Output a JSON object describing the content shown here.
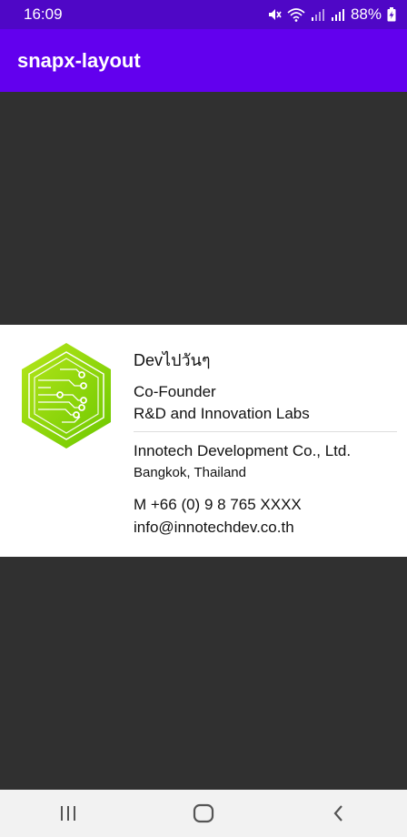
{
  "status_bar": {
    "time": "16:09",
    "battery": "88%",
    "icons": [
      "mute-icon",
      "wifi-icon",
      "signal-icon",
      "signal-icon",
      "battery-charging-icon"
    ]
  },
  "app_bar": {
    "title": "snapx-layout"
  },
  "card": {
    "name": "Devไปวันๆ",
    "role": "Co-Founder",
    "department": "R&D and Innovation Labs",
    "company": "Innotech Development Co., Ltd.",
    "location": "Bangkok, Thailand",
    "phone": "M +66 (0) 9 8 765 XXXX",
    "email": "info@innotechdev.co.th",
    "logo_icon": "circuit-hexagon-logo",
    "logo_color": "#8cd600"
  },
  "nav_bar": {
    "icons": [
      "recents-icon",
      "home-icon",
      "back-icon"
    ]
  },
  "colors": {
    "status_bar": "#4f07c6",
    "app_bar": "#6200ee",
    "background": "#303030",
    "card": "#ffffff",
    "nav_bar": "#f2f2f2"
  }
}
